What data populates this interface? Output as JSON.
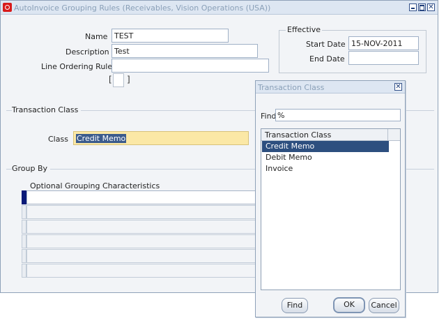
{
  "window": {
    "title": "AutoInvoice Grouping Rules (Receivables, Vision Operations (USA))",
    "controls": {
      "minimize": "",
      "maximize": "",
      "close": "✕"
    }
  },
  "form": {
    "name_label": "Name",
    "name_value": "TEST",
    "description_label": "Description",
    "description_value": "Test",
    "line_ordering_label": "Line Ordering Rule",
    "line_ordering_value": "",
    "bracket_open": "[",
    "bracket_close": "]"
  },
  "effective": {
    "legend": "Effective",
    "start_label": "Start Date",
    "start_value": "15-NOV-2011",
    "end_label": "End Date",
    "end_value": ""
  },
  "transaction_class_section": {
    "title": "Transaction Class",
    "class_label": "Class",
    "class_value": "Credit Memo"
  },
  "group_by": {
    "title": "Group By",
    "column_header": "Optional Grouping Characteristics"
  },
  "dialog": {
    "title": "Transaction Class",
    "close": "✕",
    "find_label": "Find",
    "find_value": "%",
    "list_header": "Transaction Class",
    "items": [
      "Credit Memo",
      "Debit Memo",
      "Invoice"
    ],
    "selected_index": 0,
    "find_button": "Find",
    "ok_button": "OK",
    "cancel_button": "Cancel"
  },
  "colors": {
    "highlight_field": "#fbe8a6",
    "selection": "#2d4f7f",
    "current_row_indicator": "#0a1a78",
    "logo": "#d81b1b"
  }
}
